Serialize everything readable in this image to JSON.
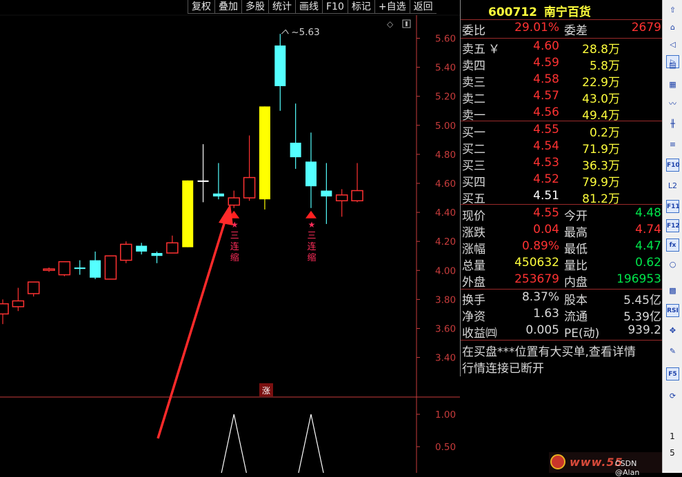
{
  "toolbar": {
    "items": [
      "复权",
      "叠加",
      "多股",
      "统计",
      "画线",
      "F10",
      "标记",
      "+自选",
      "返回"
    ]
  },
  "stock": {
    "code": "600712",
    "name": "南宁百货"
  },
  "quote": {
    "weibi": {
      "label": "委比",
      "value": "29.01%",
      "label2": "委差",
      "value2": "2679"
    },
    "asks": [
      {
        "label": "卖五",
        "mark": "￥",
        "price": "4.60",
        "vol": "28.8万"
      },
      {
        "label": "卖四",
        "price": "4.59",
        "vol": "5.8万"
      },
      {
        "label": "卖三",
        "price": "4.58",
        "vol": "22.9万"
      },
      {
        "label": "卖二",
        "price": "4.57",
        "vol": "43.0万"
      },
      {
        "label": "卖一",
        "price": "4.56",
        "vol": "49.4万"
      }
    ],
    "bids": [
      {
        "label": "买一",
        "price": "4.55",
        "vol": "0.2万"
      },
      {
        "label": "买二",
        "price": "4.54",
        "vol": "71.9万"
      },
      {
        "label": "买三",
        "price": "4.53",
        "vol": "36.3万"
      },
      {
        "label": "买四",
        "price": "4.52",
        "vol": "79.9万"
      },
      {
        "label": "买五",
        "price": "4.51",
        "vol": "81.2万"
      }
    ],
    "stats1": [
      {
        "l1": "现价",
        "v1": "4.55",
        "l2": "今开",
        "v2": "4.48"
      },
      {
        "l1": "涨跌",
        "v1": "0.04",
        "l2": "最高",
        "v2": "4.74"
      },
      {
        "l1": "涨幅",
        "v1": "0.89%",
        "l2": "最低",
        "v2": "4.47"
      },
      {
        "l1": "总量",
        "v1": "450632",
        "l2": "量比",
        "v2": "0.62"
      },
      {
        "l1": "外盘",
        "v1": "253679",
        "l2": "内盘",
        "v2": "196953"
      }
    ],
    "stats2": [
      {
        "l1": "换手",
        "v1": "8.37%",
        "l2": "股本",
        "v2": "5.45亿"
      },
      {
        "l1": "净资",
        "v1": "1.63",
        "l2": "流通",
        "v2": "5.39亿"
      },
      {
        "l1": "收益㈣",
        "v1": "0.005",
        "l2": "PE(动)",
        "v2": "939.2"
      }
    ],
    "messages": [
      "在买盘***位置有大买单,查看详情",
      "行情连接已断开"
    ]
  },
  "strip": {
    "icons": [
      "scroll-up-icon",
      "home-up-icon",
      "back-icon",
      "fwd-icon",
      "report-icon",
      "table-icon",
      "line-chart-icon",
      "kline-icon",
      "news-icon",
      "f10-icon",
      "level-icon",
      "f11-icon",
      "f12-icon",
      "fx-icon",
      "circle-icon",
      "grid-icon",
      "rsi-icon",
      "move-icon",
      "pen-icon",
      "f5-icon",
      "refresh-icon"
    ],
    "nums": [
      "1",
      "5"
    ]
  },
  "watermark": {
    "site": "www.55",
    "credit": "CSDN @Alan"
  },
  "colors": {
    "up": "#ff3232",
    "down": "#54ffff",
    "special": "#ffff00",
    "grid": "#8b0000",
    "axis": "#c83c3c",
    "label": "#ff2d5a"
  },
  "chart_data": [
    {
      "type": "candlestick",
      "ylim": [
        3.2,
        5.7
      ],
      "yticks": [
        "5.60",
        "5.40",
        "5.20",
        "5.00",
        "4.80",
        "4.60",
        "4.40",
        "4.20",
        "4.00",
        "3.80",
        "3.60",
        "3.40"
      ],
      "high_marker": "5.63",
      "candles": [
        {
          "o": 3.7,
          "h": 3.8,
          "l": 3.63,
          "c": 3.77,
          "kind": "up"
        },
        {
          "o": 3.75,
          "h": 3.88,
          "l": 3.72,
          "c": 3.79,
          "kind": "up"
        },
        {
          "o": 3.84,
          "h": 3.92,
          "l": 3.82,
          "c": 3.92,
          "kind": "up"
        },
        {
          "o": 4.01,
          "h": 4.02,
          "l": 3.99,
          "c": 4.01,
          "kind": "up"
        },
        {
          "o": 3.97,
          "h": 4.06,
          "l": 3.96,
          "c": 4.06,
          "kind": "up"
        },
        {
          "o": 4.02,
          "h": 4.07,
          "l": 3.97,
          "c": 4.01,
          "kind": "down"
        },
        {
          "o": 4.07,
          "h": 4.13,
          "l": 3.94,
          "c": 3.95,
          "kind": "down"
        },
        {
          "o": 3.94,
          "h": 4.1,
          "l": 3.94,
          "c": 4.1,
          "kind": "up"
        },
        {
          "o": 4.07,
          "h": 4.2,
          "l": 4.05,
          "c": 4.18,
          "kind": "up"
        },
        {
          "o": 4.17,
          "h": 4.19,
          "l": 4.11,
          "c": 4.13,
          "kind": "down"
        },
        {
          "o": 4.12,
          "h": 4.13,
          "l": 4.05,
          "c": 4.1,
          "kind": "down"
        },
        {
          "o": 4.12,
          "h": 4.24,
          "l": 4.12,
          "c": 4.19,
          "kind": "up"
        },
        {
          "o": 4.16,
          "h": 4.62,
          "l": 4.16,
          "c": 4.62,
          "kind": "special"
        },
        {
          "o": 4.61,
          "h": 4.87,
          "l": 4.47,
          "c": 4.62,
          "kind": "flat"
        },
        {
          "o": 4.53,
          "h": 4.74,
          "l": 4.49,
          "c": 4.51,
          "kind": "down"
        },
        {
          "o": 4.45,
          "h": 4.55,
          "l": 4.43,
          "c": 4.5,
          "kind": "up"
        },
        {
          "o": 4.5,
          "h": 4.93,
          "l": 4.48,
          "c": 4.64,
          "kind": "up"
        },
        {
          "o": 4.49,
          "h": 5.13,
          "l": 4.42,
          "c": 5.13,
          "kind": "special"
        },
        {
          "o": 5.27,
          "h": 5.63,
          "l": 5.1,
          "c": 5.55,
          "kind": "down"
        },
        {
          "o": 4.88,
          "h": 5.15,
          "l": 4.7,
          "c": 4.78,
          "kind": "down"
        },
        {
          "o": 4.75,
          "h": 4.95,
          "l": 4.43,
          "c": 4.58,
          "kind": "down"
        },
        {
          "o": 4.55,
          "h": 4.74,
          "l": 4.32,
          "c": 4.51,
          "kind": "down"
        },
        {
          "o": 4.48,
          "h": 4.56,
          "l": 4.37,
          "c": 4.52,
          "kind": "up"
        },
        {
          "o": 4.48,
          "h": 4.74,
          "l": 4.47,
          "c": 4.55,
          "kind": "up"
        }
      ],
      "signals": [
        {
          "index": 15,
          "text": [
            "三",
            "连",
            "缩"
          ]
        },
        {
          "index": 20,
          "text": [
            "三",
            "连",
            "缩"
          ]
        }
      ]
    },
    {
      "type": "line",
      "ylim": [
        0,
        1.2
      ],
      "yticks": [
        "1.00",
        "0.50"
      ],
      "tag": "涨",
      "signal_at": [
        15,
        20
      ],
      "values": [
        0,
        1.0,
        0
      ]
    }
  ]
}
